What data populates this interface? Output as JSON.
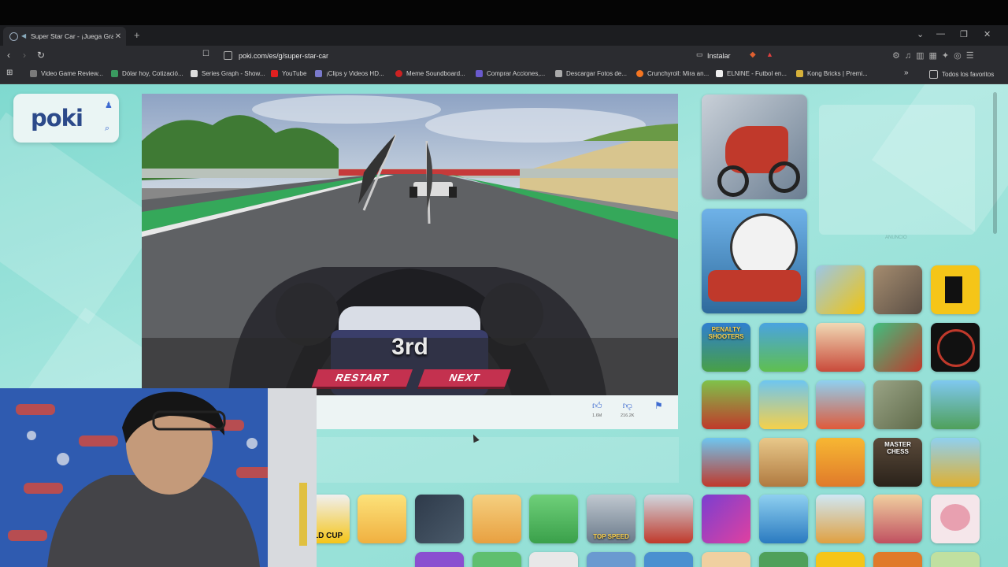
{
  "browser": {
    "tab_title": "Super Star Car - ¡Juega Grati...",
    "url": "poki.com/es/g/super-star-car",
    "install_label": "Instalar",
    "bookmarks": [
      {
        "label": "Video Game Review...",
        "color": "#7a7a7a"
      },
      {
        "label": "Dólar hoy, Cotizació...",
        "color": "#3a9a60"
      },
      {
        "label": "Series Graph - Show...",
        "color": "#dddddd"
      },
      {
        "label": "YouTube",
        "color": "#e02020"
      },
      {
        "label": "¡Clips y Videos HD...",
        "color": "#7a7acc"
      },
      {
        "label": "Meme Soundboard...",
        "color": "#cc2222"
      },
      {
        "label": "Comprar Acciones,...",
        "color": "#6a5acd"
      },
      {
        "label": "Descargar Fotos de...",
        "color": "#aaaaaa"
      },
      {
        "label": "Crunchyroll: Mira an...",
        "color": "#f47521"
      },
      {
        "label": "ELNINE - Futbol en...",
        "color": "#eeeeee"
      },
      {
        "label": "Kong Bricks | Premi...",
        "color": "#d6b13a"
      }
    ],
    "all_bookmarks_label": "Todos los favoritos"
  },
  "site": {
    "logo": "poki"
  },
  "game": {
    "position": "3rd",
    "restart_label": "RESTART",
    "next_label": "NEXT",
    "likes": "1.6M",
    "dislikes": "216.2K"
  },
  "ad_label": "ANUNCIO",
  "thumb_labels": {
    "penalty": "PENALTY SHOOTERS",
    "chess": "MASTER CHESS",
    "topspeed": "TOP SPEED",
    "worldcup": "RLD CUP"
  }
}
